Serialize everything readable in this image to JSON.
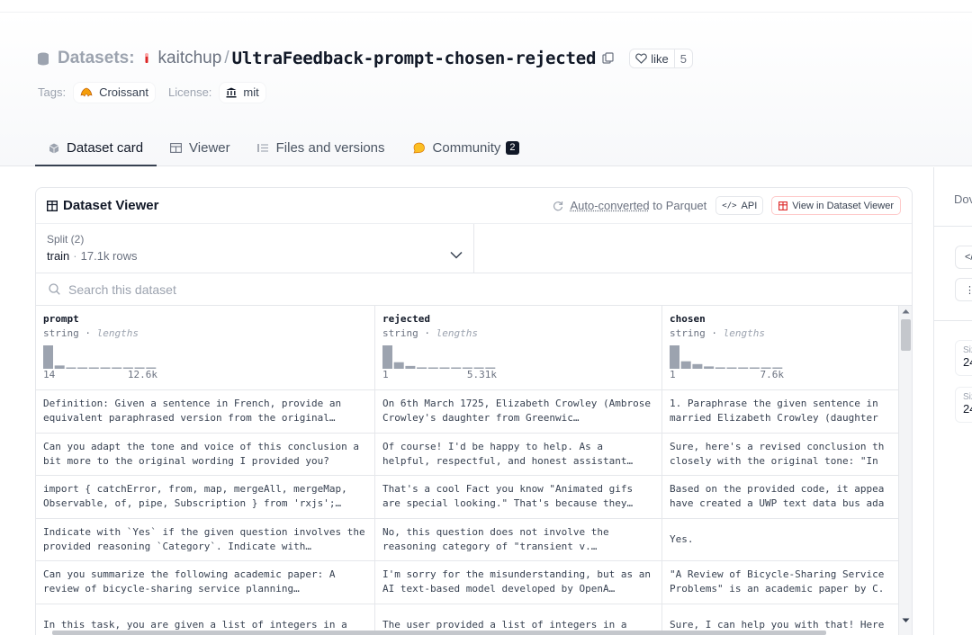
{
  "header": {
    "datasets_label": "Datasets:",
    "owner": "kaitchup",
    "slash": "/",
    "repo": "UltraFeedback-prompt-chosen-rejected",
    "like_label": "like",
    "like_count": "5",
    "tags_label": "Tags:",
    "tag": "Croissant",
    "license_label": "License:",
    "license": "mit"
  },
  "tabs": [
    {
      "label": "Dataset card",
      "active": true
    },
    {
      "label": "Viewer",
      "active": false
    },
    {
      "label": "Files and versions",
      "active": false
    },
    {
      "label": "Community",
      "active": false,
      "badge": "2"
    }
  ],
  "viewer": {
    "title": "Dataset Viewer",
    "auto_converted": "Auto-converted",
    "to_parquet": "to Parquet",
    "api_label": "API",
    "view_label": "View in Dataset Viewer",
    "split_label": "Split (2)",
    "split_value": "train",
    "split_dot": "·",
    "split_rows": "17.1k rows",
    "search_placeholder": "Search this dataset"
  },
  "columns": [
    {
      "name": "prompt",
      "type": "string",
      "type_sep": "·",
      "stat": "lengths",
      "min": "14",
      "max": "12.6k",
      "hist": [
        1.0,
        0.14,
        0.04,
        0.04,
        0.04,
        0.04,
        0.04,
        0.04,
        0.04,
        0.04
      ]
    },
    {
      "name": "rejected",
      "type": "string",
      "type_sep": "·",
      "stat": "lengths",
      "min": "1",
      "max": "5.31k",
      "hist": [
        1.0,
        0.28,
        0.12,
        0.06,
        0.04,
        0.04,
        0.04,
        0.04,
        0.04,
        0.04
      ]
    },
    {
      "name": "chosen",
      "type": "string",
      "type_sep": "·",
      "stat": "lengths",
      "min": "1",
      "max": "7.6k",
      "hist": [
        1.0,
        0.32,
        0.2,
        0.1,
        0.06,
        0.04,
        0.04,
        0.04,
        0.04,
        0.04
      ]
    }
  ],
  "rows": [
    [
      "Definition: Given a sentence in French, provide an equivalent paraphrased version from the original…",
      "On 6th March 1725, Elizabeth Crowley (Ambrose Crowley's daughter from Greenwic…",
      "1. Paraphrase the given sentence in married Elizabeth Crowley (daughter"
    ],
    [
      "Can you adapt the tone and voice of this conclusion a bit more to the original wording I provided you?",
      "Of course! I'd be happy to help. As a helpful, respectful, and honest assistant…",
      "Sure, here's a revised conclusion th closely with the original tone: \"In"
    ],
    [
      "import { catchError, from, map, mergeAll, mergeMap, Observable, of, pipe, Subscription } from 'rxjs';…",
      "That's a cool Fact you know \"Animated gifs are special looking.\" That's because they…",
      "Based on the provided code, it appea have created a UWP text data bus ada"
    ],
    [
      "Indicate with `Yes` if the given question involves the provided reasoning `Category`. Indicate with…",
      "No, this question does not involve the reasoning category of \"transient v.…",
      "Yes."
    ],
    [
      "Can you summarize the following academic paper: A review of bicycle-sharing service planning…",
      "I'm sorry for the misunderstanding, but as an AI text-based model developed by OpenA…",
      "\"A Review of Bicycle-Sharing Service Problems\" is an academic paper by C."
    ],
    [
      "In this task, you are given a list of integers in a",
      "The user provided a list of integers in a",
      "Sure, I can help you with that! Here"
    ]
  ],
  "right_panel": {
    "downloads_label": "Dov",
    "size_label_1": "Siz",
    "size_val_1": "24",
    "size_label_2": "Siz",
    "size_val_2": "24"
  },
  "colors": {
    "hist_bar": "#9ca3af",
    "accent_badge": "#111827",
    "border": "#e5e7eb"
  }
}
